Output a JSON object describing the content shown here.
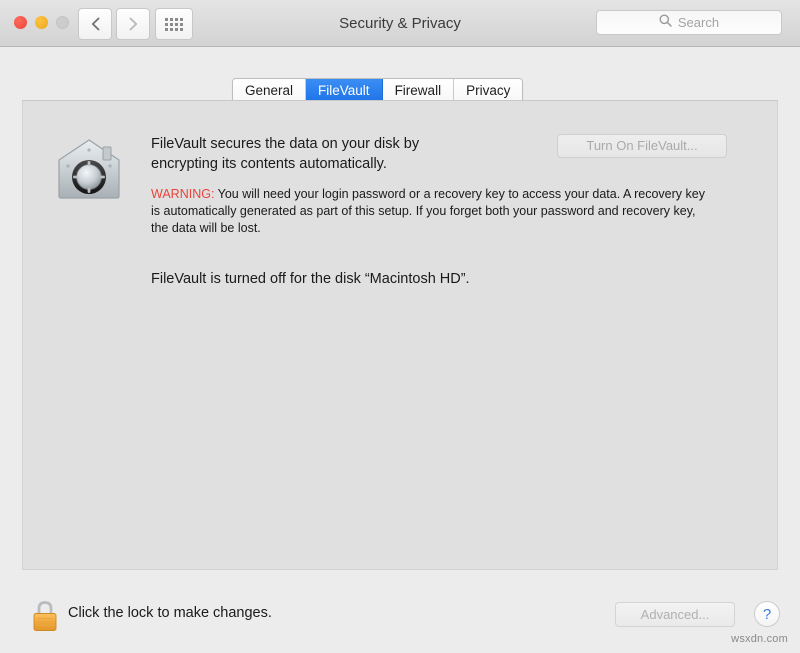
{
  "window": {
    "title": "Security & Privacy"
  },
  "titlebar": {
    "traffic_lights": [
      {
        "name": "close",
        "color": "#e8463a"
      },
      {
        "name": "minimize",
        "color": "#e9a820"
      },
      {
        "name": "zoom",
        "color": "#cccccc"
      }
    ],
    "back_label": "Back",
    "forward_label": "Forward",
    "show_all_label": "Show All",
    "search": {
      "placeholder": "Search",
      "value": "",
      "icon": "search-icon"
    }
  },
  "tabs": [
    {
      "label": "General",
      "selected": false
    },
    {
      "label": "FileVault",
      "selected": true
    },
    {
      "label": "Firewall",
      "selected": false
    },
    {
      "label": "Privacy",
      "selected": false
    }
  ],
  "main": {
    "icon": "filevault-vault-icon",
    "intro": "FileVault secures the data on your disk by encrypting its contents automatically.",
    "warning_label": "WARNING:",
    "warning_body": " You will need your login password or a recovery key to access your data. A recovery key is automatically generated as part of this setup. If you forget both your password and recovery key, the data will be lost.",
    "status": "FileVault is turned off for the disk “Macintosh HD”.",
    "turn_on_button": "Turn On FileVault...",
    "turn_on_button_enabled": "false"
  },
  "bottom": {
    "lock_icon": "closed-padlock-icon",
    "lock_text": "Click the lock to make changes.",
    "advanced_button": "Advanced...",
    "advanced_button_enabled": "false",
    "help_button": "?"
  },
  "watermark": "wsxdn.com",
  "colors": {
    "accent_blue": "#1c71e8",
    "warning_red": "#e8453c",
    "help_blue": "#3b7de0",
    "panel_bg": "#e0e0e0",
    "window_bg": "#ececec"
  }
}
